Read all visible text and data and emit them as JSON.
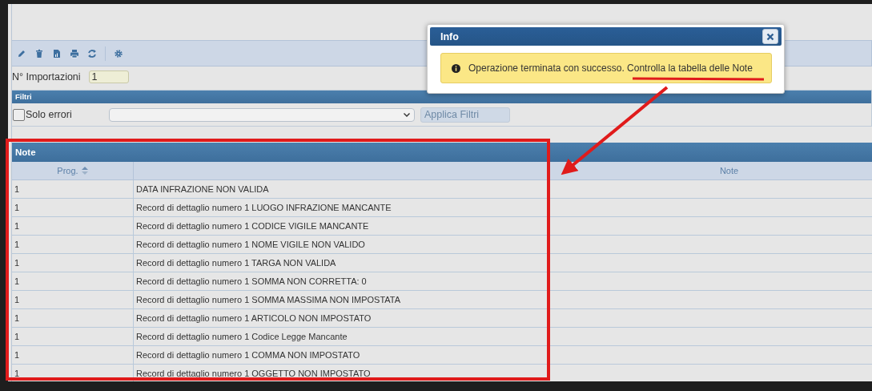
{
  "import_count": {
    "label": "N° Importazioni",
    "value": "1"
  },
  "filters": {
    "title": "Filtri",
    "checkbox": {
      "label": "Solo errori",
      "checked": false
    },
    "apply_button": "Applica Filtri"
  },
  "notes_table": {
    "title": "Note",
    "columns": [
      {
        "label": "Prog."
      },
      {
        "label": "Note"
      }
    ],
    "rows": [
      {
        "prog": "1",
        "note": "DATA INFRAZIONE NON VALIDA"
      },
      {
        "prog": "1",
        "note": "Record di dettaglio numero 1 LUOGO INFRAZIONE MANCANTE"
      },
      {
        "prog": "1",
        "note": "Record di dettaglio numero 1 CODICE VIGILE MANCANTE"
      },
      {
        "prog": "1",
        "note": "Record di dettaglio numero 1 NOME VIGILE NON VALIDO"
      },
      {
        "prog": "1",
        "note": "Record di dettaglio numero 1 TARGA NON VALIDA"
      },
      {
        "prog": "1",
        "note": "Record di dettaglio numero 1 SOMMA NON CORRETTA: 0"
      },
      {
        "prog": "1",
        "note": "Record di dettaglio numero 1 SOMMA MASSIMA NON IMPOSTATA"
      },
      {
        "prog": "1",
        "note": "Record di dettaglio numero 1 ARTICOLO NON IMPOSTATO"
      },
      {
        "prog": "1",
        "note": "Record di dettaglio numero 1 Codice Legge Mancante"
      },
      {
        "prog": "1",
        "note": "Record di dettaglio numero 1 COMMA NON IMPOSTATO"
      },
      {
        "prog": "1",
        "note": "Record di dettaglio numero 1 OGGETTO NON IMPOSTATO"
      }
    ]
  },
  "dialog": {
    "title": "Info",
    "message": "Operazione terminata con successo. Controlla la tabella delle Note"
  }
}
